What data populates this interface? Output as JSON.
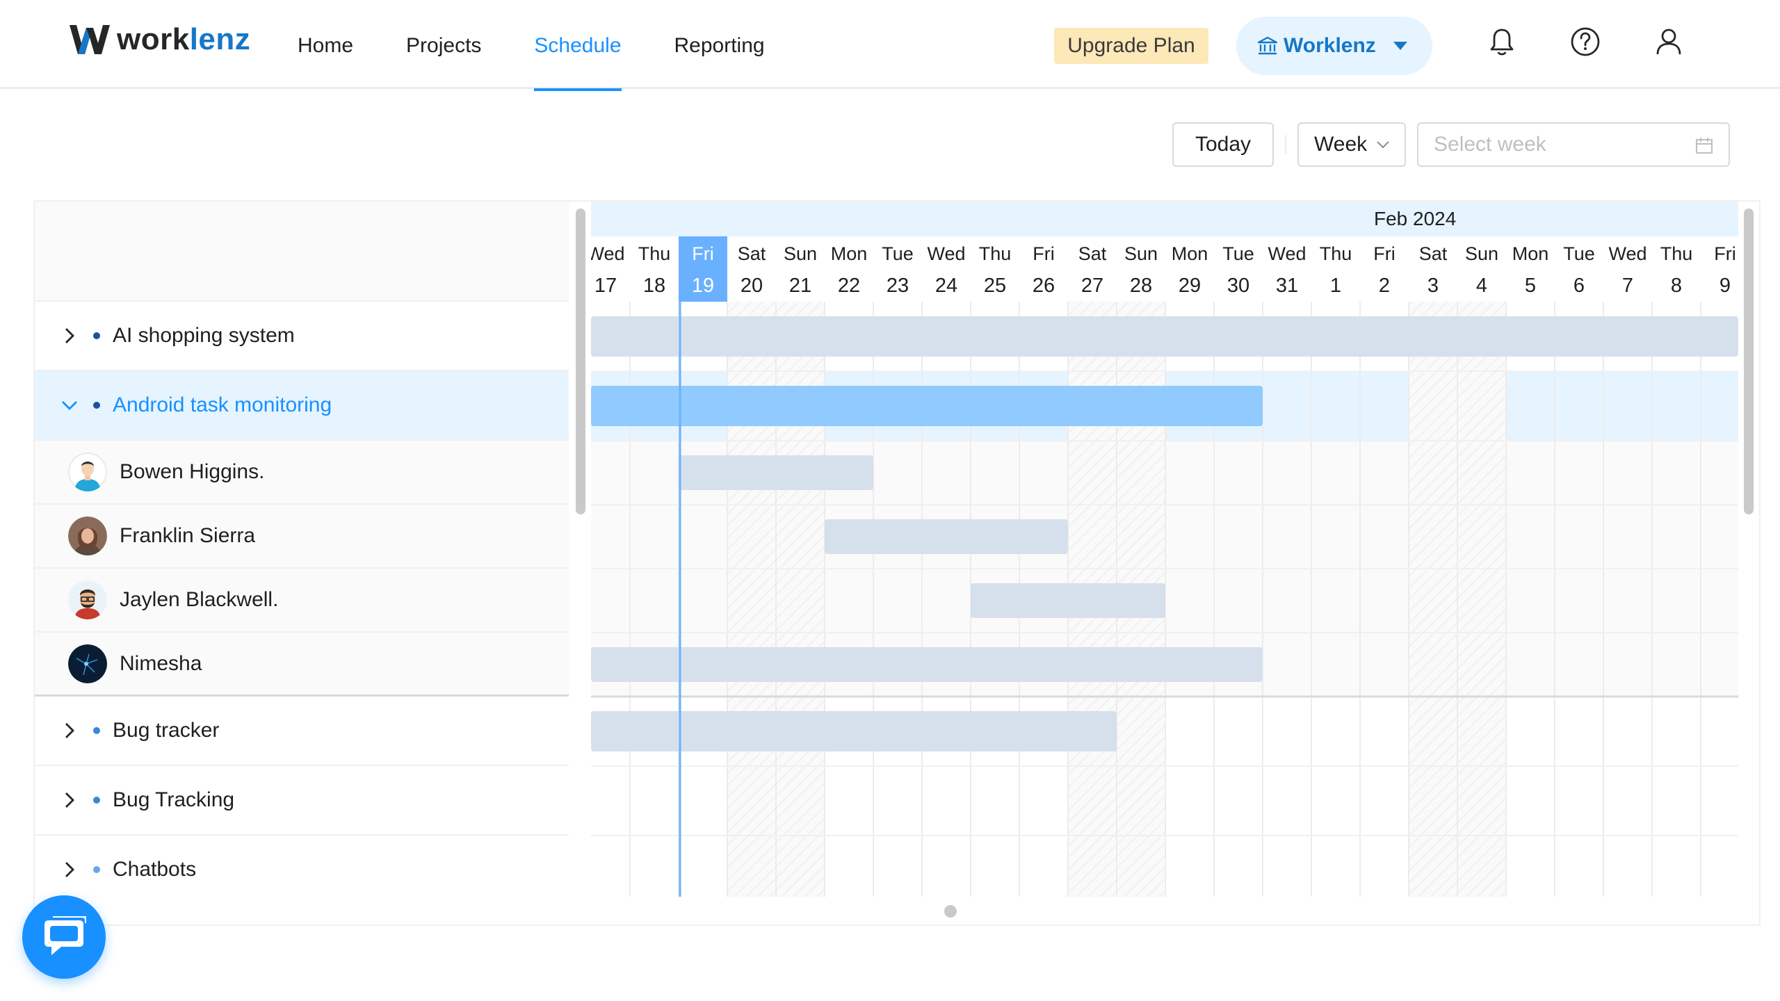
{
  "app": {
    "logo_part1": "work",
    "logo_part2": "lenz",
    "accent_color": "#1890ff",
    "brand_color": "#1677c8"
  },
  "nav": {
    "items": [
      {
        "label": "Home",
        "active": false
      },
      {
        "label": "Projects",
        "active": false
      },
      {
        "label": "Schedule",
        "active": true
      },
      {
        "label": "Reporting",
        "active": false
      }
    ]
  },
  "header": {
    "upgrade_label": "Upgrade Plan",
    "team_label": "Worklenz",
    "icons": [
      "bell-icon",
      "help-icon",
      "user-icon"
    ]
  },
  "toolbar": {
    "today_label": "Today",
    "view_value": "Week",
    "week_placeholder": "Select week"
  },
  "calendar": {
    "month_label": "Feb 2024",
    "today_index": 2,
    "weekend_indices": [
      3,
      4,
      10,
      11,
      17,
      18
    ],
    "days": [
      {
        "dow": "Wed",
        "num": "17"
      },
      {
        "dow": "Thu",
        "num": "18"
      },
      {
        "dow": "Fri",
        "num": "19"
      },
      {
        "dow": "Sat",
        "num": "20"
      },
      {
        "dow": "Sun",
        "num": "21"
      },
      {
        "dow": "Mon",
        "num": "22"
      },
      {
        "dow": "Tue",
        "num": "23"
      },
      {
        "dow": "Wed",
        "num": "24"
      },
      {
        "dow": "Thu",
        "num": "25"
      },
      {
        "dow": "Fri",
        "num": "26"
      },
      {
        "dow": "Sat",
        "num": "27"
      },
      {
        "dow": "Sun",
        "num": "28"
      },
      {
        "dow": "Mon",
        "num": "29"
      },
      {
        "dow": "Tue",
        "num": "30"
      },
      {
        "dow": "Wed",
        "num": "31"
      },
      {
        "dow": "Thu",
        "num": "1"
      },
      {
        "dow": "Fri",
        "num": "2"
      },
      {
        "dow": "Sat",
        "num": "3"
      },
      {
        "dow": "Sun",
        "num": "4"
      },
      {
        "dow": "Mon",
        "num": "5"
      },
      {
        "dow": "Tue",
        "num": "6"
      },
      {
        "dow": "Wed",
        "num": "7"
      },
      {
        "dow": "Thu",
        "num": "8"
      },
      {
        "dow": "Fri",
        "num": "9"
      }
    ]
  },
  "rows": [
    {
      "kind": "project",
      "label": "AI shopping system",
      "dot_color": "#1f4fa0",
      "expanded": false,
      "bar": [
        0,
        24
      ],
      "bar_color": "#d6e0ec"
    },
    {
      "kind": "project",
      "label": "Android task monitoring",
      "dot_color": "#1f4fa0",
      "expanded": true,
      "bar": [
        0,
        14
      ],
      "bar_color": "#91caff"
    },
    {
      "kind": "member",
      "label": "Bowen Higgins.",
      "avatar": "avatar-bowen",
      "bar": [
        2,
        6
      ],
      "bar_color": "#d6e0ec"
    },
    {
      "kind": "member",
      "label": "Franklin Sierra",
      "avatar": "avatar-franklin",
      "bar": [
        5,
        10
      ],
      "bar_color": "#d6e0ec"
    },
    {
      "kind": "member",
      "label": "Jaylen Blackwell.",
      "avatar": "avatar-jaylen",
      "bar": [
        8,
        12
      ],
      "bar_color": "#d6e0ec"
    },
    {
      "kind": "member",
      "label": "Nimesha",
      "avatar": "avatar-nimesha",
      "bar": [
        0,
        14
      ],
      "bar_color": "#d6e0ec",
      "last_in_group": true
    },
    {
      "kind": "project",
      "label": "Bug tracker",
      "dot_color": "#3a86d8",
      "expanded": false,
      "bar": [
        0,
        11
      ],
      "bar_color": "#d6e0ec"
    },
    {
      "kind": "project",
      "label": "Bug Tracking",
      "dot_color": "#3a86d8",
      "expanded": false
    },
    {
      "kind": "project",
      "label": "Chatbots",
      "dot_color": "#6aa8e8",
      "expanded": false
    }
  ]
}
